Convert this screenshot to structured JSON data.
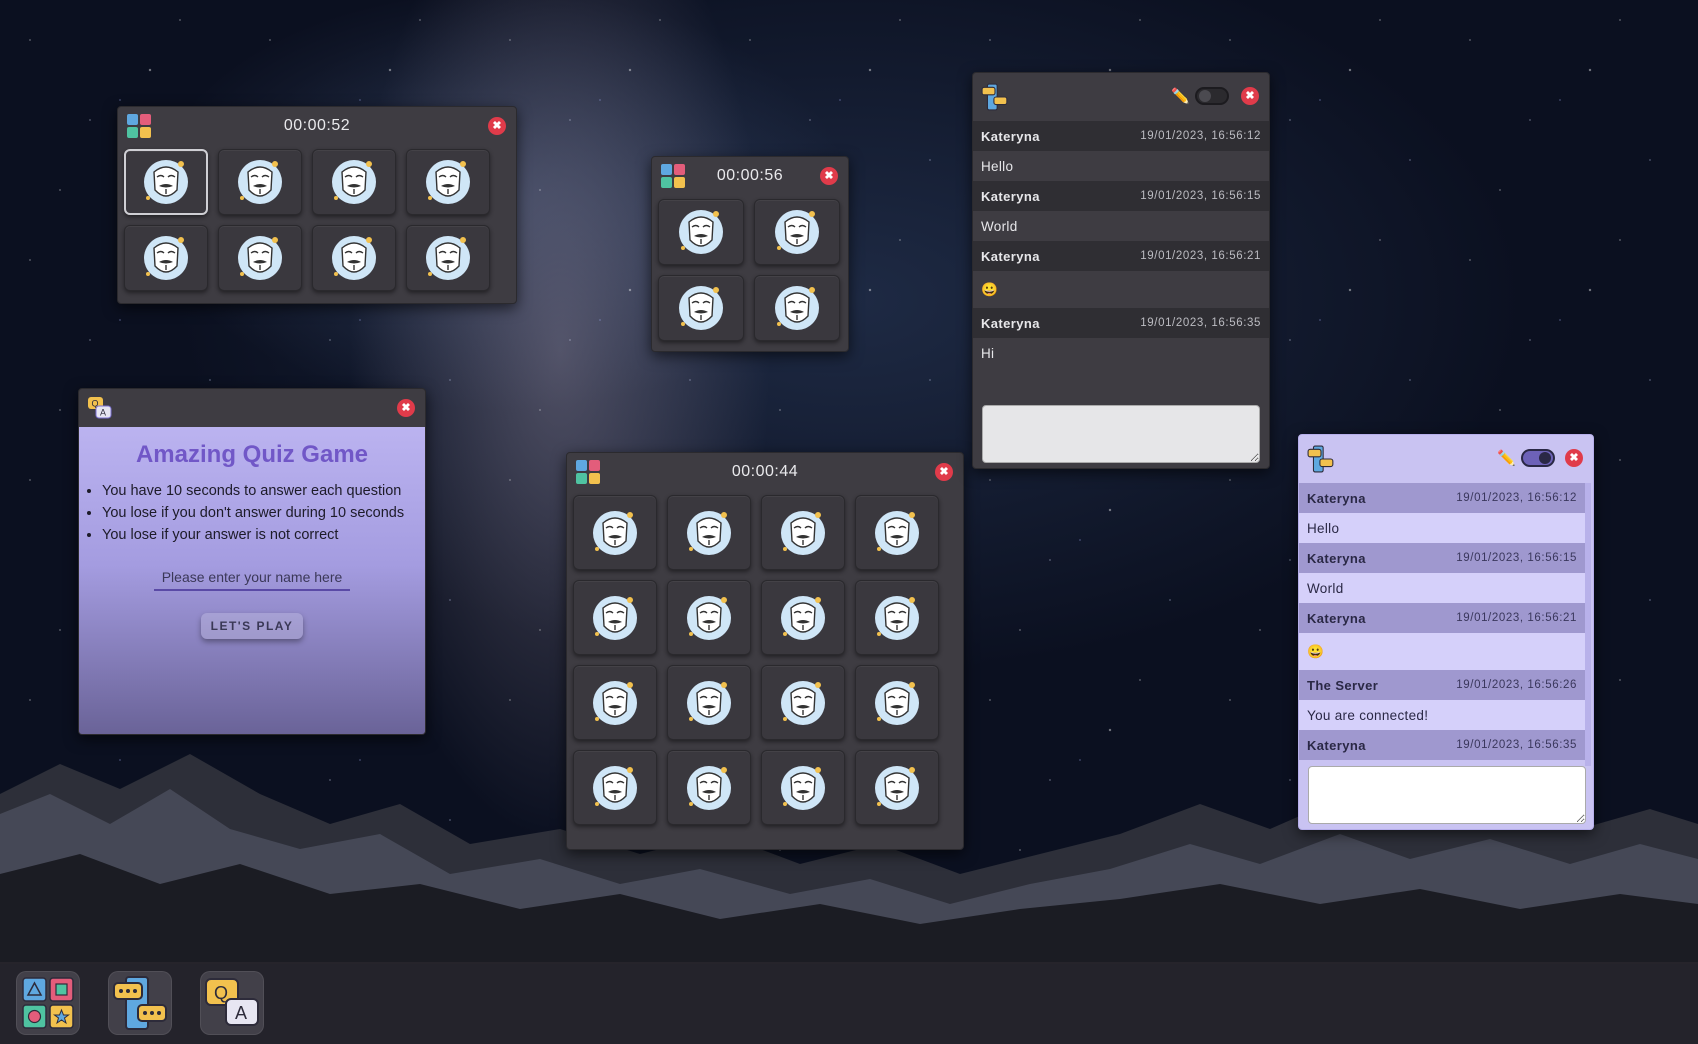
{
  "memory_windows": [
    {
      "timer": "00:00:52",
      "cards": 8
    },
    {
      "timer": "00:00:56",
      "cards": 4
    },
    {
      "timer": "00:00:44",
      "cards": 16
    }
  ],
  "close_glyph": "✖",
  "chat_dark": {
    "messages": [
      {
        "author": "Kateryna",
        "time": "19/01/2023, 16:56:12",
        "text": "Hello"
      },
      {
        "author": "Kateryna",
        "time": "19/01/2023, 16:56:15",
        "text": "World"
      },
      {
        "author": "Kateryna",
        "time": "19/01/2023, 16:56:21",
        "text": "😀"
      },
      {
        "author": "Kateryna",
        "time": "19/01/2023, 16:56:35",
        "text": "Hi"
      }
    ],
    "input_value": "",
    "pencil_icon": "✏️"
  },
  "chat_light": {
    "messages": [
      {
        "author": "Kateryna",
        "time": "19/01/2023, 16:56:12",
        "text": "Hello"
      },
      {
        "author": "Kateryna",
        "time": "19/01/2023, 16:56:15",
        "text": "World"
      },
      {
        "author": "Kateryna",
        "time": "19/01/2023, 16:56:21",
        "text": "😀"
      },
      {
        "author": "The Server",
        "time": "19/01/2023, 16:56:26",
        "text": "You are connected!"
      },
      {
        "author": "Kateryna",
        "time": "19/01/2023, 16:56:35",
        "text": ""
      }
    ],
    "input_value": "",
    "pencil_icon": "✏️"
  },
  "quiz": {
    "title": "Amazing Quiz Game",
    "rules": [
      "You have 10 seconds to answer each question",
      "You lose if you don't answer during 10 seconds",
      "You lose if your answer is not correct"
    ],
    "name_placeholder": "Please enter your name here",
    "play_label": "LET'S PLAY"
  },
  "taskbar": [
    "memory-game-app-icon",
    "chat-app-icon",
    "quiz-app-icon"
  ],
  "colors": {
    "close": "#e03b4a",
    "window_dark": "#3e3c42",
    "chat_light_bg": "#c9c3f2",
    "quiz_title": "#7157c7"
  }
}
